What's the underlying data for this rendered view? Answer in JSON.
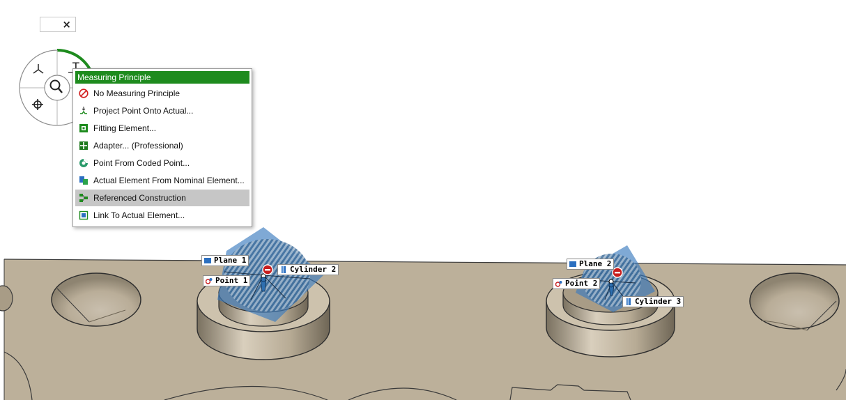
{
  "toolbar": {
    "close_label": "×"
  },
  "radial_menu": {
    "top_tool_glyph": "T"
  },
  "context_menu": {
    "header": "Measuring Principle",
    "items": [
      {
        "label": "No Measuring Principle",
        "icon": "no-entry-icon"
      },
      {
        "label": "Project Point Onto Actual...",
        "icon": "project-point-icon"
      },
      {
        "label": "Fitting Element...",
        "icon": "fitting-element-icon"
      },
      {
        "label": "Adapter... (Professional)",
        "icon": "adapter-icon"
      },
      {
        "label": "Point From Coded Point...",
        "icon": "coded-point-icon"
      },
      {
        "label": "Actual Element From Nominal Element...",
        "icon": "actual-element-icon"
      },
      {
        "label": "Referenced Construction",
        "icon": "referenced-construction-icon",
        "highlighted": true
      },
      {
        "label": "Link To Actual Element...",
        "icon": "link-element-icon"
      }
    ]
  },
  "scene_labels": {
    "plane_1": "Plane 1",
    "point_1": "Point 1",
    "cylinder_2": "Cylinder 2",
    "plane_2": "Plane 2",
    "point_2": "Point 2",
    "cylinder_3": "Cylinder 3"
  },
  "colors": {
    "header_green": "#1e8b1e",
    "part_surface": "#bcb09a",
    "highlight": "#c6c6c6",
    "plane_blue": "#3a7bbf"
  }
}
